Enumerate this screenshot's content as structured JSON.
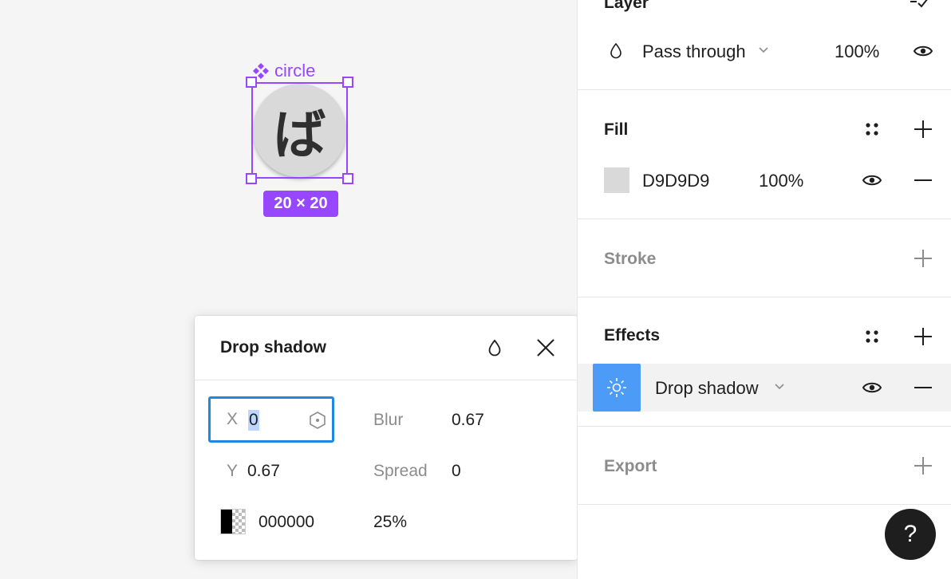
{
  "canvas": {
    "component_name": "circle",
    "glyph": "ば",
    "size_label": "20 × 20"
  },
  "popover": {
    "title": "Drop shadow",
    "x_label": "X",
    "x_value": "0",
    "y_label": "Y",
    "y_value": "0.67",
    "blur_label": "Blur",
    "blur_value": "0.67",
    "spread_label": "Spread",
    "spread_value": "0",
    "color_hex": "000000",
    "opacity": "25%"
  },
  "panel": {
    "layer": {
      "title": "Layer",
      "blend_mode": "Pass through",
      "opacity": "100%"
    },
    "fill": {
      "title": "Fill",
      "color_hex": "D9D9D9",
      "opacity": "100%",
      "swatch_color": "#D9D9D9"
    },
    "stroke": {
      "title": "Stroke"
    },
    "effects": {
      "title": "Effects",
      "effect_type": "Drop shadow"
    },
    "export": {
      "title": "Export"
    },
    "help_label": "?"
  },
  "colors": {
    "selection": "#9747FF",
    "focus": "#1E88E5",
    "effect_button": "#4B9BF7"
  }
}
